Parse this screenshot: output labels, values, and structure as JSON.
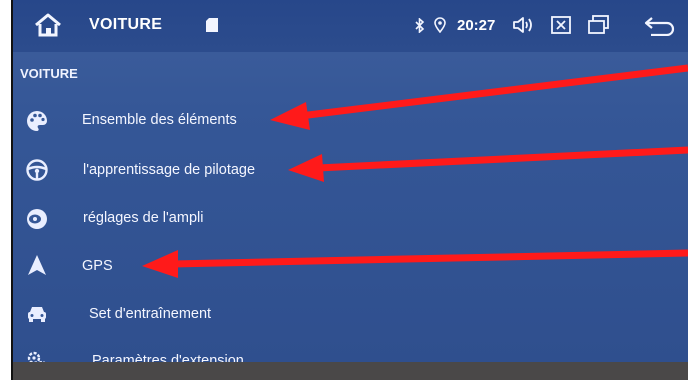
{
  "statusbar": {
    "title": "VOITURE",
    "time": "20:27"
  },
  "section": {
    "header": "VOITURE"
  },
  "menu": {
    "items": [
      {
        "label": "Ensemble des éléments",
        "icon": "palette-icon"
      },
      {
        "label": "l'apprentissage de pilotage",
        "icon": "steering-wheel-icon"
      },
      {
        "label": "réglages de l'ampli",
        "icon": "speaker-icon"
      },
      {
        "label": "GPS",
        "icon": "navigation-arrow-icon"
      },
      {
        "label": "Set d'entraînement",
        "icon": "car-icon"
      },
      {
        "label": "Paramètres d'extension",
        "icon": "gears-icon"
      }
    ]
  },
  "colors": {
    "screen_bg": "#355797",
    "statusbar_bg": "#27478a",
    "text": "#f4f6ff",
    "annotation_arrow": "#ff1a1a"
  }
}
